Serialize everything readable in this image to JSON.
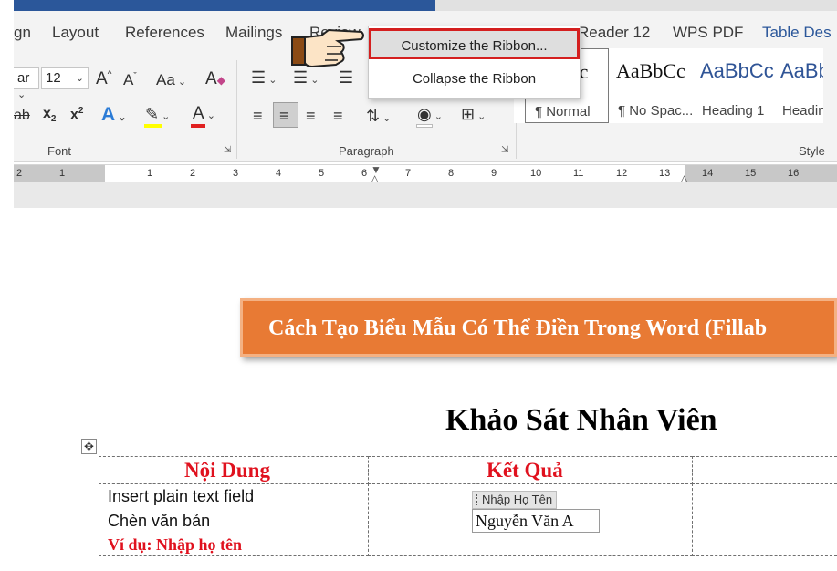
{
  "ribbon": {
    "tabs": [
      {
        "label": "gn"
      },
      {
        "label": "Layout"
      },
      {
        "label": "References"
      },
      {
        "label": "Mailings"
      },
      {
        "label": "Review"
      },
      {
        "label": "Reader 12"
      },
      {
        "label": "WPS PDF"
      },
      {
        "label": "Table Des"
      }
    ],
    "font": {
      "name_fragment": "ar",
      "size": "12",
      "grow_glyph": "A",
      "shrink_glyph": "A",
      "case_glyph": "Aa",
      "clear_glyph": "A",
      "strike_glyph": "ab",
      "sub_glyph": "x",
      "sub_mark": "2",
      "sup_glyph": "x",
      "sup_mark": "2",
      "effects_glyph": "A",
      "color_glyph": "A",
      "group_label": "Font"
    },
    "paragraph": {
      "group_label": "Paragraph"
    },
    "styles": {
      "tiles": [
        {
          "sample": "Cc",
          "name": "¶ Normal"
        },
        {
          "sample": "AaBbCc",
          "name": "¶ No Spac..."
        },
        {
          "sample": "AaBbCc",
          "name": "Heading 1"
        },
        {
          "sample": "AaBbC",
          "name": "Headin"
        }
      ],
      "group_label": "Style"
    },
    "accent_color": "#2b579a"
  },
  "context_menu": {
    "items": [
      {
        "label": "Customize the Ribbon...",
        "highlighted": true
      },
      {
        "label": "Collapse the Ribbon",
        "highlighted": false
      }
    ],
    "highlight_color": "#d41f1f"
  },
  "ruler": {
    "left_labels": [
      "2",
      "1"
    ],
    "right_labels": [
      "1",
      "2",
      "3",
      "4",
      "5",
      "6",
      "7",
      "8",
      "9",
      "10",
      "11",
      "12",
      "13",
      "14",
      "15",
      "16"
    ]
  },
  "document": {
    "banner": {
      "text": "Cách Tạo Biểu Mẫu Có Thể Điền Trong Word (Fillab",
      "color": "#e87a34"
    },
    "title": "Khảo Sát Nhân Viên",
    "table": {
      "headers": [
        "Nội Dung",
        "Kết Quả"
      ],
      "row": {
        "line1": "Insert plain text field",
        "line2": "Chèn văn bản",
        "example": "Ví dụ: Nhập họ tên",
        "control_tag": "Nhập Họ Tên",
        "control_value": "Nguyễn Văn A"
      },
      "header_color": "#e0111e"
    }
  }
}
